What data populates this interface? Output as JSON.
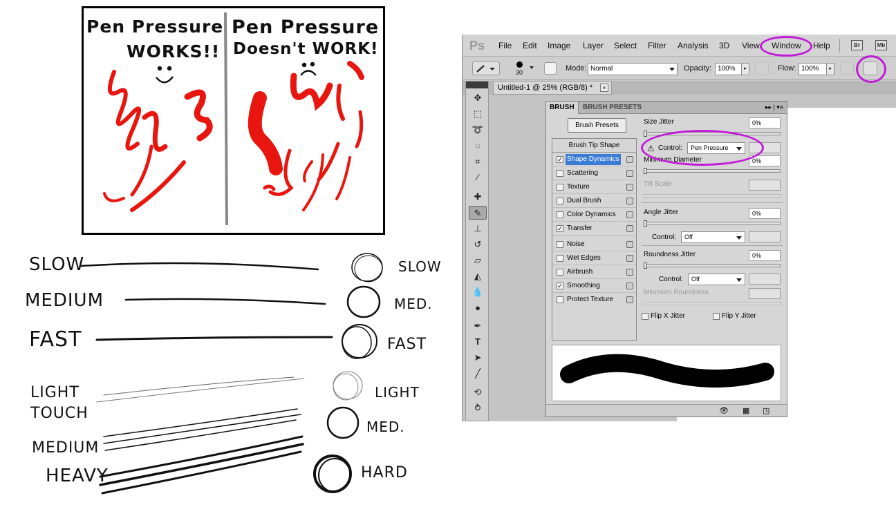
{
  "comic": {
    "left_title_line1": "Pen Pressure",
    "left_title_line2": "WORKS!!",
    "right_title_line1": "Pen Pressure",
    "right_title_line2": "Doesn't WORK!"
  },
  "speed": {
    "labels_left": [
      "SLOW",
      "MEDIUM",
      "FAST"
    ],
    "labels_right": [
      "SLOW",
      "MED.",
      "FAST"
    ]
  },
  "pressure": {
    "labels_left": [
      "LIGHT",
      "TOUCH",
      "MEDIUM",
      "HEAVY"
    ],
    "labels_right": [
      "LIGHT",
      "MED.",
      "HARD"
    ]
  },
  "photoshop": {
    "logo": "Ps",
    "menu": [
      "File",
      "Edit",
      "Image",
      "Layer",
      "Select",
      "Filter",
      "Analysis",
      "3D",
      "View",
      "Window",
      "Help"
    ],
    "bridge_button": "Br",
    "minibridge_button": "Mb",
    "options": {
      "brush_size": "30",
      "mode_label": "Mode:",
      "mode_value": "Normal",
      "opacity_label": "Opacity:",
      "opacity_value": "100%",
      "flow_label": "Flow:",
      "flow_value": "100%"
    },
    "document_tab": "Untitled-1 @ 25% (RGB/8) *",
    "brush_panel": {
      "tabs": [
        "BRUSH",
        "BRUSH PRESETS"
      ],
      "presets_button": "Brush Presets",
      "tip_shape": "Brush Tip Shape",
      "items": [
        {
          "label": "Shape Dynamics",
          "checked": true,
          "selected": true
        },
        {
          "label": "Scattering",
          "checked": false
        },
        {
          "label": "Texture",
          "checked": false
        },
        {
          "label": "Dual Brush",
          "checked": false
        },
        {
          "label": "Color Dynamics",
          "checked": false
        },
        {
          "label": "Transfer",
          "checked": true
        },
        {
          "label": "Noise",
          "checked": false
        },
        {
          "label": "Wet Edges",
          "checked": false
        },
        {
          "label": "Airbrush",
          "checked": false
        },
        {
          "label": "Smoothing",
          "checked": true
        },
        {
          "label": "Protect Texture",
          "checked": false
        }
      ],
      "size_jitter_label": "Size Jitter",
      "size_jitter_value": "0%",
      "control_label": "Control:",
      "size_control_value": "Pen Pressure",
      "min_diameter_label": "Minimum Diameter",
      "min_diameter_value": "0%",
      "tilt_scale_label": "Tilt Scale",
      "angle_jitter_label": "Angle Jitter",
      "angle_jitter_value": "0%",
      "angle_control_value": "Off",
      "roundness_jitter_label": "Roundness Jitter",
      "roundness_jitter_value": "0%",
      "roundness_control_value": "Off",
      "min_roundness_label": "Minimum Roundness",
      "flip_x_label": "Flip X Jitter",
      "flip_y_label": "Flip Y Jitter"
    },
    "highlight_color": "#c21bd8"
  }
}
